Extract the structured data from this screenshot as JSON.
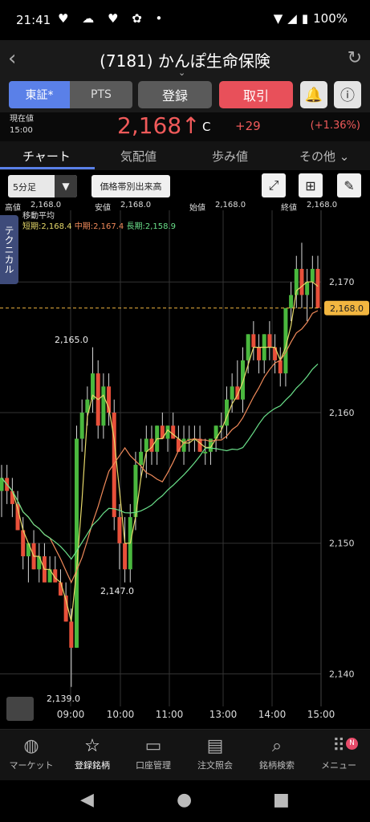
{
  "statusbar": {
    "time": "21:41",
    "notif_icons": "♥ ☁ ♥ ✿ •",
    "battery": "100%"
  },
  "header": {
    "title": "(7181) かんぽ生命保険"
  },
  "buttons": {
    "market_active": "東証*",
    "market_pts": "PTS",
    "register": "登録",
    "trade": "取引"
  },
  "price": {
    "label_current": "現在値",
    "label_time": "15:00",
    "value": "2,168",
    "arrow": "↑",
    "suffix": "C",
    "change": "+29",
    "change_pct": "(+1.36%)"
  },
  "tabs": [
    {
      "label": "チャート"
    },
    {
      "label": "気配値"
    },
    {
      "label": "歩み値"
    },
    {
      "label": "その他"
    }
  ],
  "tools": {
    "interval": "5分足",
    "volume_by_price": "価格帯別出来高"
  },
  "ohlc": {
    "high_label": "高値",
    "high": "2,168.0",
    "low_label": "安値",
    "low": "2,168.0",
    "open_label": "始値",
    "open": "2,168.0",
    "close_label": "終値",
    "close": "2,168.0"
  },
  "ma": {
    "title": "移動平均",
    "short": "短期:2,168.4",
    "mid": "中期:2,167.4",
    "long": "長期:2,158.9"
  },
  "technical_tab": "テクニカル",
  "chart_data": {
    "type": "line",
    "y_ticks": [
      "2,170",
      "2,160",
      "2,150",
      "2,140"
    ],
    "x_ticks": [
      "09:00",
      "10:00",
      "11:00",
      "13:00",
      "14:00",
      "15:00"
    ],
    "current_price_label": "2,168.0",
    "annotations": [
      "2,165.0",
      "2,147.0",
      "2,139.0"
    ],
    "candles": [
      [
        2154,
        2156,
        2152,
        2155
      ],
      [
        2155,
        2156,
        2153,
        2154
      ],
      [
        2154,
        2155,
        2152,
        2153
      ],
      [
        2153,
        2154,
        2151,
        2151
      ],
      [
        2151,
        2152,
        2148,
        2149
      ],
      [
        2149,
        2150,
        2147,
        2150
      ],
      [
        2150,
        2151,
        2148,
        2148
      ],
      [
        2148,
        2150,
        2147,
        2149
      ],
      [
        2149,
        2150,
        2147,
        2147
      ],
      [
        2147,
        2149,
        2147,
        2148
      ],
      [
        2148,
        2149,
        2147,
        2147
      ],
      [
        2147,
        2148,
        2146,
        2146
      ],
      [
        2146,
        2147,
        2144,
        2144
      ],
      [
        2144,
        2145,
        2139,
        2142
      ],
      [
        2142,
        2159,
        2142,
        2158
      ],
      [
        2158,
        2161,
        2157,
        2160
      ],
      [
        2160,
        2162,
        2159,
        2161
      ],
      [
        2161,
        2165,
        2160,
        2163
      ],
      [
        2163,
        2164,
        2158,
        2159
      ],
      [
        2159,
        2163,
        2158,
        2162
      ],
      [
        2162,
        2163,
        2159,
        2160
      ],
      [
        2160,
        2161,
        2151,
        2152
      ],
      [
        2152,
        2153,
        2148,
        2150
      ],
      [
        2150,
        2152,
        2147,
        2148
      ],
      [
        2148,
        2153,
        2147,
        2152
      ],
      [
        2152,
        2157,
        2151,
        2156
      ],
      [
        2156,
        2158,
        2155,
        2157
      ],
      [
        2157,
        2159,
        2155,
        2158
      ],
      [
        2158,
        2159,
        2156,
        2157
      ],
      [
        2157,
        2159,
        2156,
        2159
      ],
      [
        2159,
        2160,
        2158,
        2158
      ],
      [
        2158,
        2159,
        2157,
        2159
      ],
      [
        2159,
        2160,
        2158,
        2158
      ],
      [
        2158,
        2159,
        2157,
        2157
      ],
      [
        2157,
        2159,
        2156,
        2158
      ],
      [
        2158,
        2159,
        2157,
        2158
      ],
      [
        2158,
        2159,
        2157,
        2158
      ],
      [
        2158,
        2159,
        2157,
        2157
      ],
      [
        2157,
        2158,
        2156,
        2157
      ],
      [
        2157,
        2158,
        2156,
        2158
      ],
      [
        2158,
        2159,
        2157,
        2159
      ],
      [
        2159,
        2160,
        2158,
        2159
      ],
      [
        2159,
        2162,
        2158,
        2161
      ],
      [
        2161,
        2163,
        2160,
        2162
      ],
      [
        2162,
        2164,
        2161,
        2161
      ],
      [
        2161,
        2165,
        2160,
        2164
      ],
      [
        2164,
        2166,
        2163,
        2166
      ],
      [
        2166,
        2167,
        2164,
        2165
      ],
      [
        2165,
        2166,
        2163,
        2164
      ],
      [
        2164,
        2166,
        2163,
        2166
      ],
      [
        2166,
        2167,
        2164,
        2165
      ],
      [
        2165,
        2166,
        2163,
        2164
      ],
      [
        2164,
        2165,
        2162,
        2163
      ],
      [
        2163,
        2168,
        2162,
        2168
      ],
      [
        2168,
        2170,
        2167,
        2169
      ],
      [
        2169,
        2172,
        2168,
        2171
      ],
      [
        2171,
        2173,
        2168,
        2169
      ],
      [
        2169,
        2171,
        2167,
        2170
      ],
      [
        2170,
        2172,
        2168,
        2171
      ],
      [
        2171,
        2172,
        2168,
        2168
      ]
    ]
  },
  "bottomnav": [
    {
      "label": "マーケット",
      "icon": "globe-icon"
    },
    {
      "label": "登録銘柄",
      "icon": "star-icon"
    },
    {
      "label": "口座管理",
      "icon": "card-icon"
    },
    {
      "label": "注文照会",
      "icon": "document-icon"
    },
    {
      "label": "銘柄検索",
      "icon": "search-icon"
    },
    {
      "label": "メニュー",
      "icon": "grid-icon",
      "badge": "N"
    }
  ],
  "colors": {
    "up": "#e8503a",
    "down": "#4ab83e",
    "accent": "#5a80e8",
    "price_tag": "#f2b640"
  }
}
